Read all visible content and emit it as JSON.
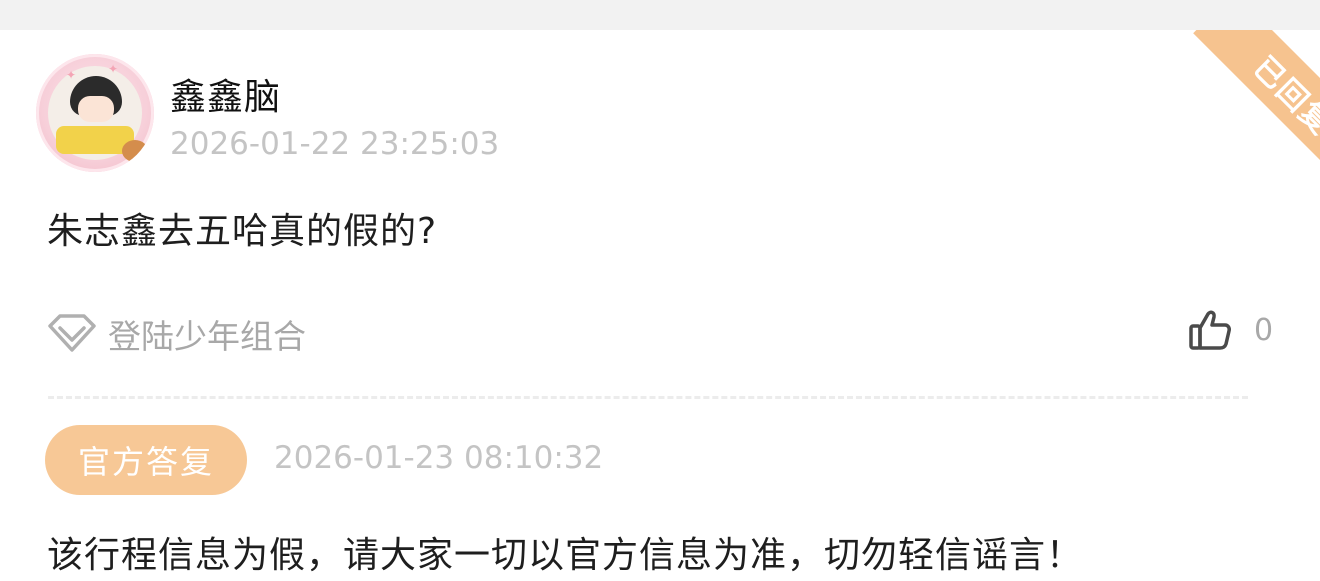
{
  "comment": {
    "replied_ribbon": "已回复",
    "username": "鑫鑫脑",
    "timestamp": "2026-01-22 23:25:03",
    "text": "朱志鑫去五哈真的假的?",
    "topic": "登陆少年组合",
    "like_count": "0"
  },
  "official_reply": {
    "badge": "官方答复",
    "timestamp": "2026-01-23 08:10:32",
    "text": "该行程信息为假，请大家一切以官方信息为准，切勿轻信谣言！"
  },
  "icons": {
    "topic": "diamond-icon",
    "like": "thumbs-up-icon"
  },
  "colors": {
    "accent_orange": "#f7c896",
    "muted_text": "#c4c4c4"
  }
}
